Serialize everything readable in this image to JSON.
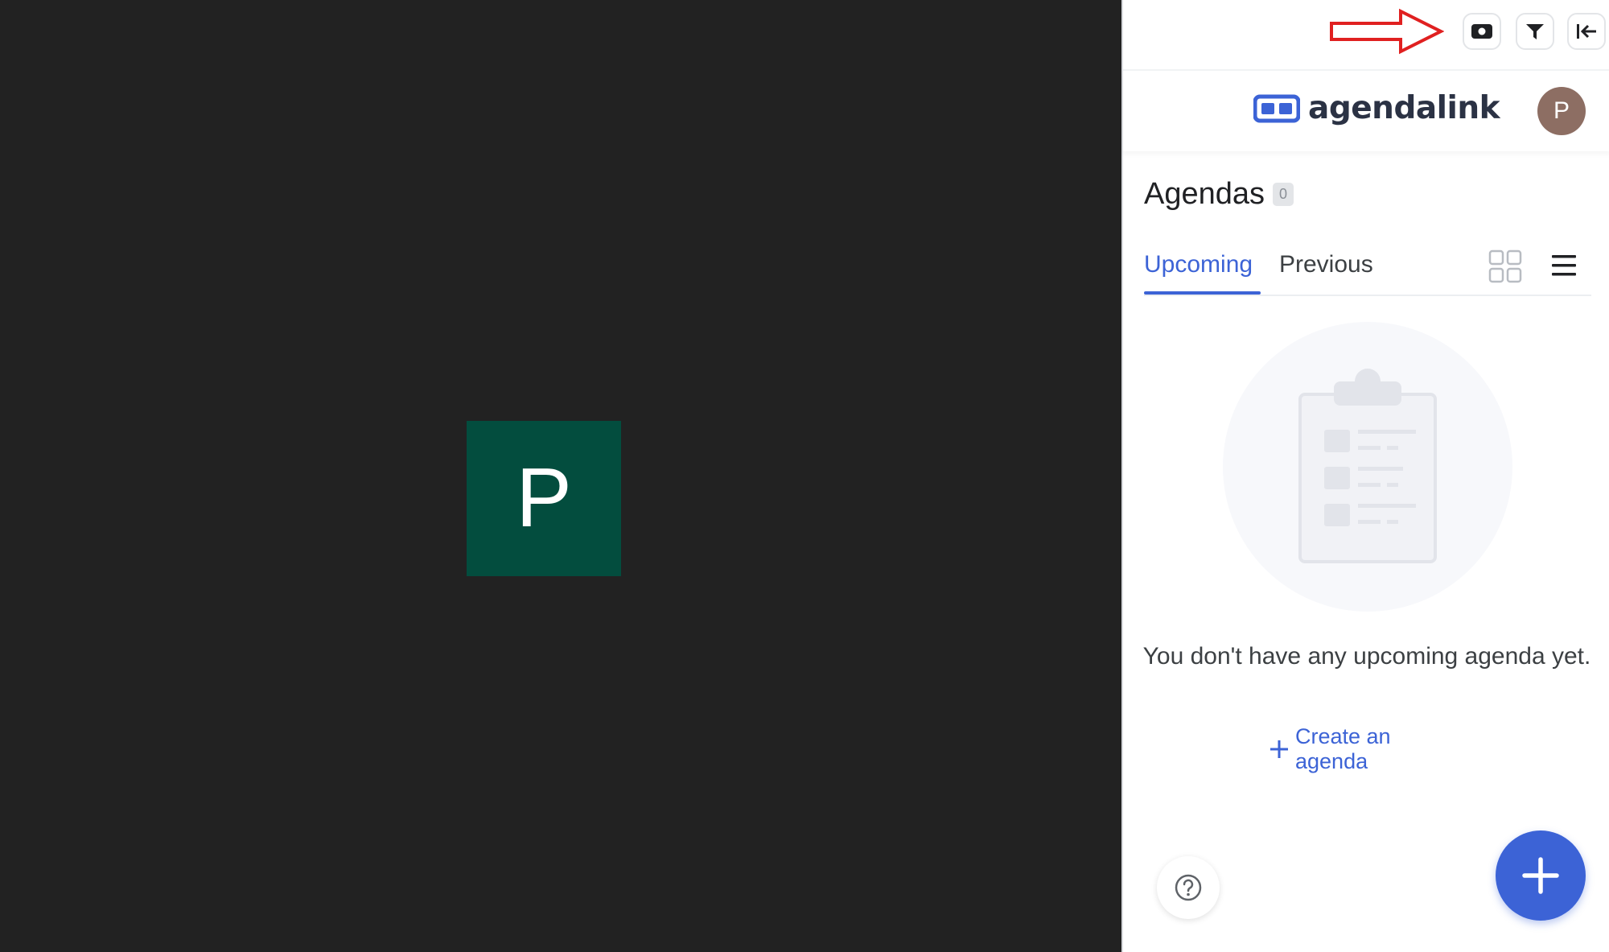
{
  "stage": {
    "participant_initial": "P",
    "tile_color": "#034d3e"
  },
  "toolbar": {
    "buttons": [
      {
        "icon": "camera-icon"
      },
      {
        "icon": "filter-icon"
      },
      {
        "icon": "collapse-panel-icon"
      }
    ],
    "annotation": "red-arrow-icon"
  },
  "brand": {
    "logo_text": "agendalink",
    "logo_icon": "agendalink-logo-icon",
    "avatar_initial": "P",
    "accent": "#3c63d6"
  },
  "agendas": {
    "title": "Agendas",
    "count": "0",
    "tabs": [
      {
        "label": "Upcoming",
        "active": true
      },
      {
        "label": "Previous",
        "active": false
      }
    ],
    "view_icons": [
      "grid-view-icon",
      "list-view-icon"
    ]
  },
  "empty_state": {
    "illustration": "clipboard-icon",
    "message": "You don't have any upcoming agenda yet.",
    "create_label": "Create an agenda"
  },
  "footer": {
    "help_icon": "help-icon",
    "fab_icon": "plus-icon"
  }
}
